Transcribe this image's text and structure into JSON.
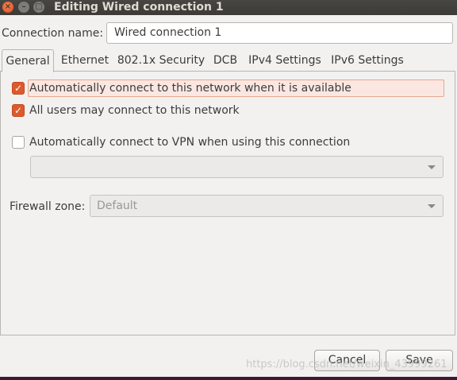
{
  "window": {
    "title": "Editing Wired connection 1",
    "close_glyph": "×",
    "minimize_glyph": "–",
    "maximize_glyph": "□"
  },
  "connection": {
    "name_label": "Connection name:",
    "name_value": "Wired connection 1"
  },
  "tabs": [
    {
      "label": "General",
      "active": true
    },
    {
      "label": "Ethernet",
      "active": false
    },
    {
      "label": "802.1x Security",
      "active": false
    },
    {
      "label": "DCB",
      "active": false
    },
    {
      "label": "IPv4 Settings",
      "active": false
    },
    {
      "label": "IPv6 Settings",
      "active": false
    }
  ],
  "general": {
    "auto_connect": {
      "label": "Automatically connect to this network when it is available",
      "checked": true
    },
    "all_users": {
      "label": "All users may connect to this network",
      "checked": true
    },
    "vpn_auto": {
      "label": "Automatically connect to VPN when using this connection",
      "checked": false
    },
    "vpn_select_value": "",
    "firewall_label": "Firewall zone:",
    "firewall_value": "Default"
  },
  "buttons": {
    "cancel": "Cancel",
    "save": "Save"
  },
  "watermark": "https://blog.csdn.net/weixin_43999261",
  "colors": {
    "accent": "#dd5a2c",
    "titlebar": "#3c3b37",
    "background": "#f2f1f0"
  }
}
